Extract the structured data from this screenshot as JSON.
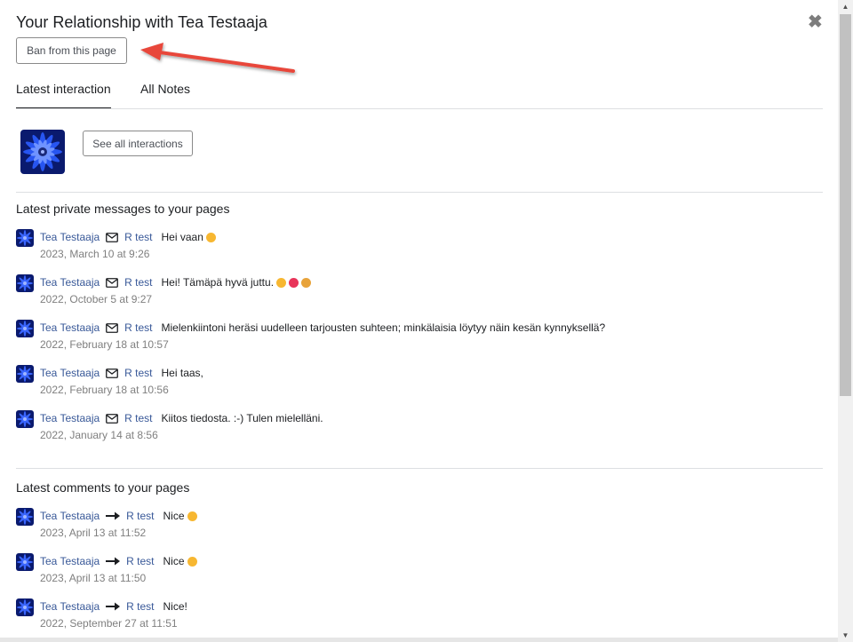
{
  "modal": {
    "title": "Your Relationship with Tea Testaaja",
    "close_glyph": "✖",
    "ban_button": "Ban from this page"
  },
  "tabs": [
    {
      "label": "Latest interaction",
      "active": true
    },
    {
      "label": "All Notes",
      "active": false
    }
  ],
  "interactions_button": "See all interactions",
  "messages_section": {
    "title": "Latest private messages to your pages",
    "icon": "envelope-icon",
    "items": [
      {
        "from": "Tea Testaaja",
        "to": "R test",
        "text": "Hei vaan",
        "emojis": [
          "#f7b731"
        ],
        "time": "2023, March 10 at 9:26"
      },
      {
        "from": "Tea Testaaja",
        "to": "R test",
        "text": "Hei! Tämäpä hyvä juttu.",
        "emojis": [
          "#f7b731",
          "#e8345a",
          "#e8a33a"
        ],
        "time": "2022, October 5 at 9:27"
      },
      {
        "from": "Tea Testaaja",
        "to": "R test",
        "text": "Mielenkiintoni heräsi uudelleen tarjousten suhteen; minkälaisia löytyy näin kesän kynnyksellä?",
        "emojis": [],
        "time": "2022, February 18 at 10:57"
      },
      {
        "from": "Tea Testaaja",
        "to": "R test",
        "text": "Hei taas,",
        "emojis": [],
        "time": "2022, February 18 at 10:56"
      },
      {
        "from": "Tea Testaaja",
        "to": "R test",
        "text": "Kiitos tiedosta. :-) Tulen mielelläni.",
        "emojis": [],
        "time": "2022, January 14 at 8:56"
      }
    ]
  },
  "comments_section": {
    "title": "Latest comments to your pages",
    "icon": "arrow-right-icon",
    "items": [
      {
        "from": "Tea Testaaja",
        "to": "R test",
        "text": "Nice",
        "emojis": [
          "#f7b731"
        ],
        "time": "2023, April 13 at 11:52"
      },
      {
        "from": "Tea Testaaja",
        "to": "R test",
        "text": "Nice",
        "emojis": [
          "#f7b731"
        ],
        "time": "2023, April 13 at 11:50"
      },
      {
        "from": "Tea Testaaja",
        "to": "R test",
        "text": "Nice!",
        "emojis": [],
        "time": "2022, September 27 at 11:51"
      }
    ]
  },
  "colors": {
    "link": "#385898",
    "annotation_arrow": "#e8473b",
    "muted_text": "#7f7f7f"
  }
}
